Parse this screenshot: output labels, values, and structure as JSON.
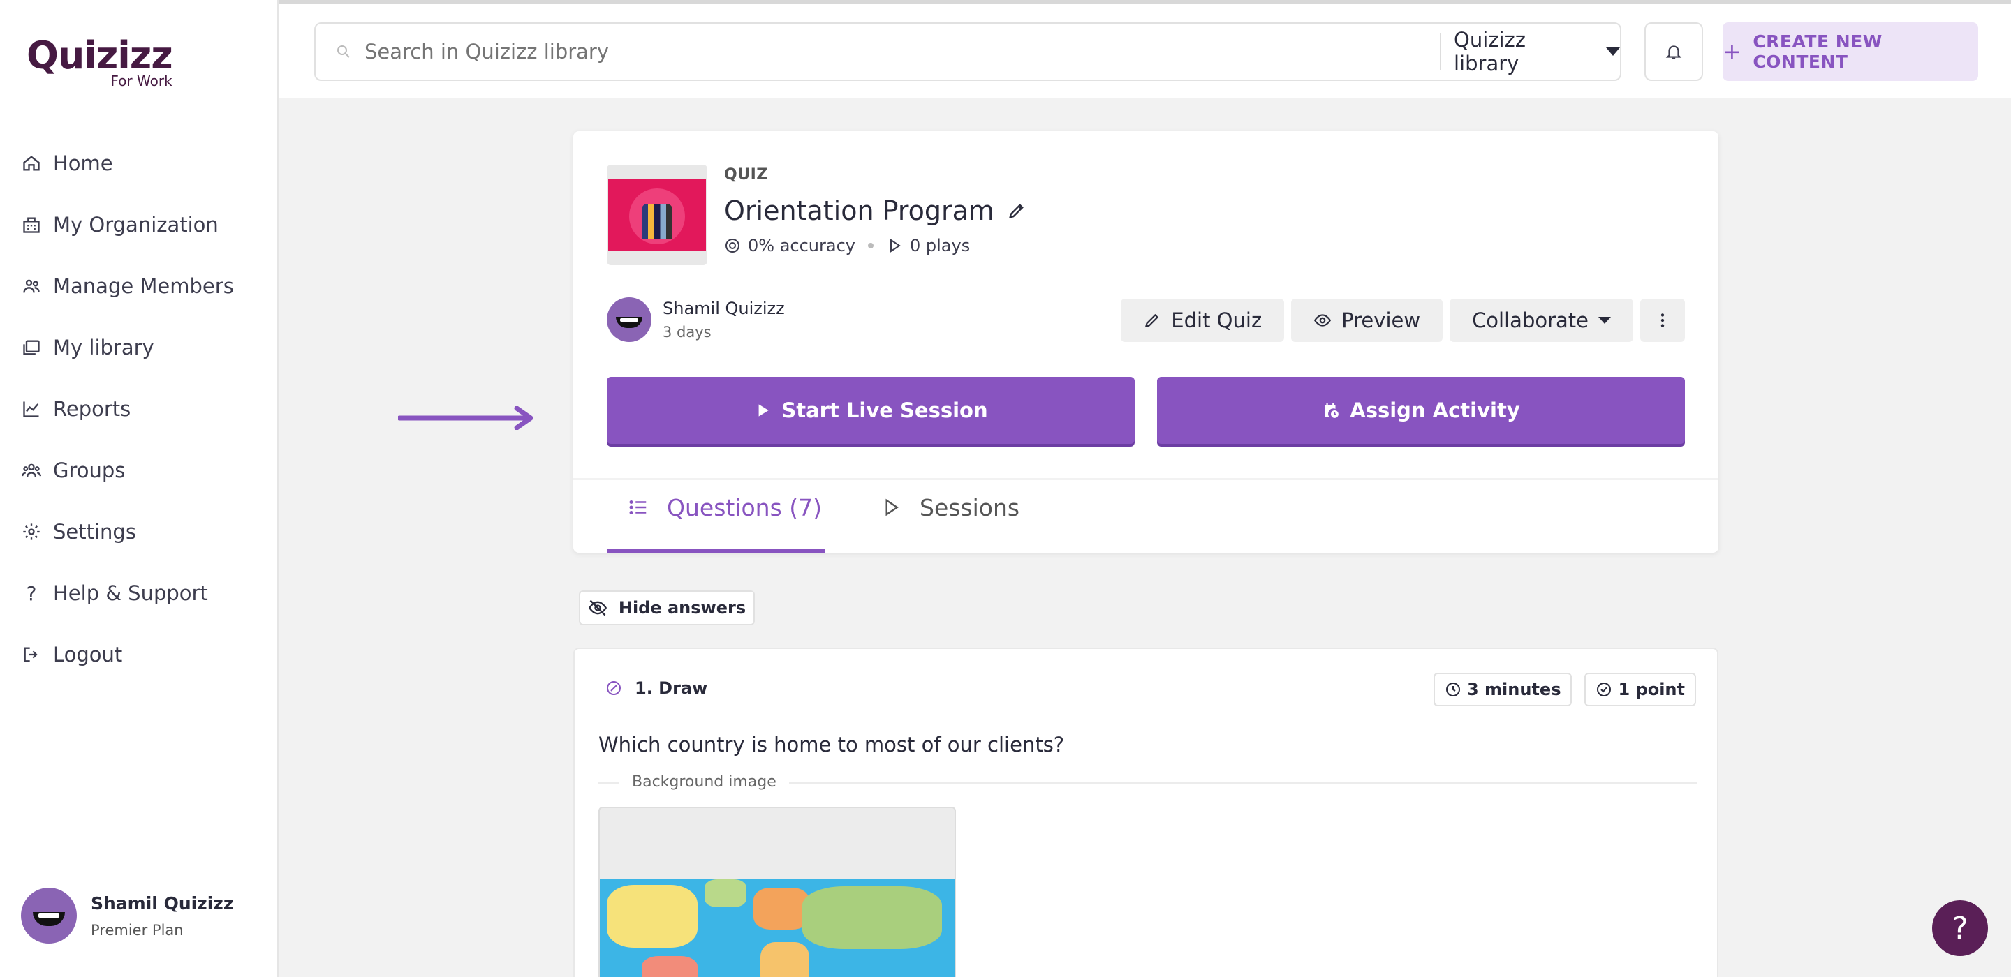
{
  "brand": {
    "logo_main": "Quizizz",
    "logo_sub": "For Work"
  },
  "sidebar": {
    "items": [
      {
        "label": "Home",
        "icon": "home-icon"
      },
      {
        "label": "My Organization",
        "icon": "organization-icon"
      },
      {
        "label": "Manage Members",
        "icon": "members-icon"
      },
      {
        "label": "My library",
        "icon": "library-icon"
      },
      {
        "label": "Reports",
        "icon": "reports-icon"
      },
      {
        "label": "Groups",
        "icon": "groups-icon"
      },
      {
        "label": "Settings",
        "icon": "gear-icon"
      },
      {
        "label": "Help & Support",
        "icon": "question-icon"
      },
      {
        "label": "Logout",
        "icon": "logout-icon"
      }
    ],
    "profile": {
      "name": "Shamil Quizizz",
      "plan": "Premier Plan"
    }
  },
  "topbar": {
    "search_placeholder": "Search in Quizizz library",
    "library_select": "Quizizz library",
    "create_label": "CREATE NEW CONTENT"
  },
  "quiz": {
    "type": "QUIZ",
    "title": "Orientation Program",
    "accuracy": "0% accuracy",
    "plays": "0 plays",
    "author": "Shamil Quizizz",
    "time": "3 days",
    "actions": {
      "edit": "Edit Quiz",
      "preview": "Preview",
      "collaborate": "Collaborate"
    },
    "start_label": "Start Live Session",
    "assign_label": "Assign Activity",
    "tabs": {
      "questions": "Questions (7)",
      "sessions": "Sessions"
    }
  },
  "hide_answers": "Hide answers",
  "question": {
    "heading": "1. Draw",
    "duration": "3 minutes",
    "points": "1 point",
    "text": "Which country is home to most of our clients?",
    "bg_label": "Background image"
  },
  "colors": {
    "accent": "#8854c0",
    "brand": "#461a42",
    "help_button": "#5a1f57"
  },
  "help_label": "?"
}
